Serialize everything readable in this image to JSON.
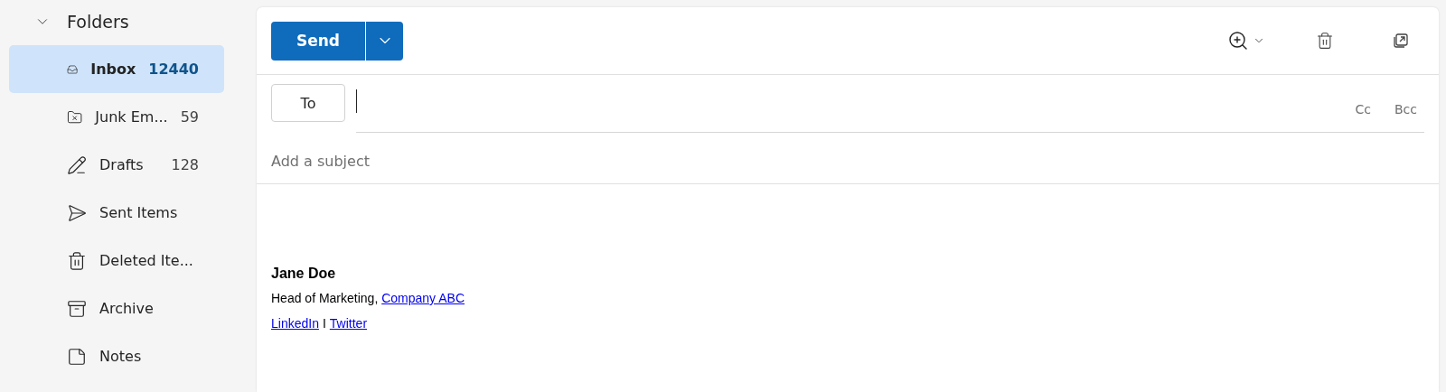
{
  "sidebar": {
    "header": "Folders",
    "expanded": true,
    "items": [
      {
        "kind": "inbox",
        "label": "Inbox",
        "count": "12440",
        "selected": true
      },
      {
        "kind": "junk",
        "label": "Junk Em...",
        "count": "59",
        "selected": false
      },
      {
        "kind": "drafts",
        "label": "Drafts",
        "count": "128",
        "selected": false
      },
      {
        "kind": "sent",
        "label": "Sent Items",
        "selected": false
      },
      {
        "kind": "deleted",
        "label": "Deleted Ite...",
        "selected": false
      },
      {
        "kind": "archive",
        "label": "Archive",
        "selected": false
      },
      {
        "kind": "notes",
        "label": "Notes",
        "selected": false
      }
    ]
  },
  "compose": {
    "send_button": "Send",
    "to_button": "To",
    "cc": "Cc",
    "bcc": "Bcc",
    "subject": {
      "placeholder": "Add a subject"
    },
    "signature": {
      "name": "Jane Doe",
      "title": "Head of Marketing,",
      "company_link": "Company ABC",
      "links": [
        "LinkedIn",
        "Twitter"
      ],
      "separator": "I"
    }
  }
}
